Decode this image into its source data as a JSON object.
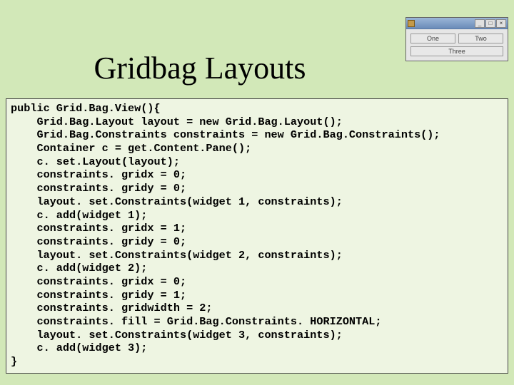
{
  "title": "Gridbag Layouts",
  "mini_window": {
    "btn_one": "One",
    "btn_two": "Two",
    "btn_three": "Three",
    "ctrl_min": "_",
    "ctrl_max": "□",
    "ctrl_close": "×"
  },
  "code": {
    "l00": "public Grid.Bag.View(){",
    "l01": "    Grid.Bag.Layout layout = new Grid.Bag.Layout();",
    "l02": "    Grid.Bag.Constraints constraints = new Grid.Bag.Constraints();",
    "l03": "    Container c = get.Content.Pane();",
    "l04": "    c. set.Layout(layout);",
    "l05": "    constraints. gridx = 0;",
    "l06": "    constraints. gridy = 0;",
    "l07": "    layout. set.Constraints(widget 1, constraints);",
    "l08": "    c. add(widget 1);",
    "l09": "    constraints. gridx = 1;",
    "l10": "    constraints. gridy = 0;",
    "l11": "    layout. set.Constraints(widget 2, constraints);",
    "l12": "    c. add(widget 2);",
    "l13": "    constraints. gridx = 0;",
    "l14": "    constraints. gridy = 1;",
    "l15": "    constraints. gridwidth = 2;",
    "l16": "    constraints. fill = Grid.Bag.Constraints. HORIZONTAL;",
    "l17": "    layout. set.Constraints(widget 3, constraints);",
    "l18": "    c. add(widget 3);",
    "l19": "}"
  }
}
